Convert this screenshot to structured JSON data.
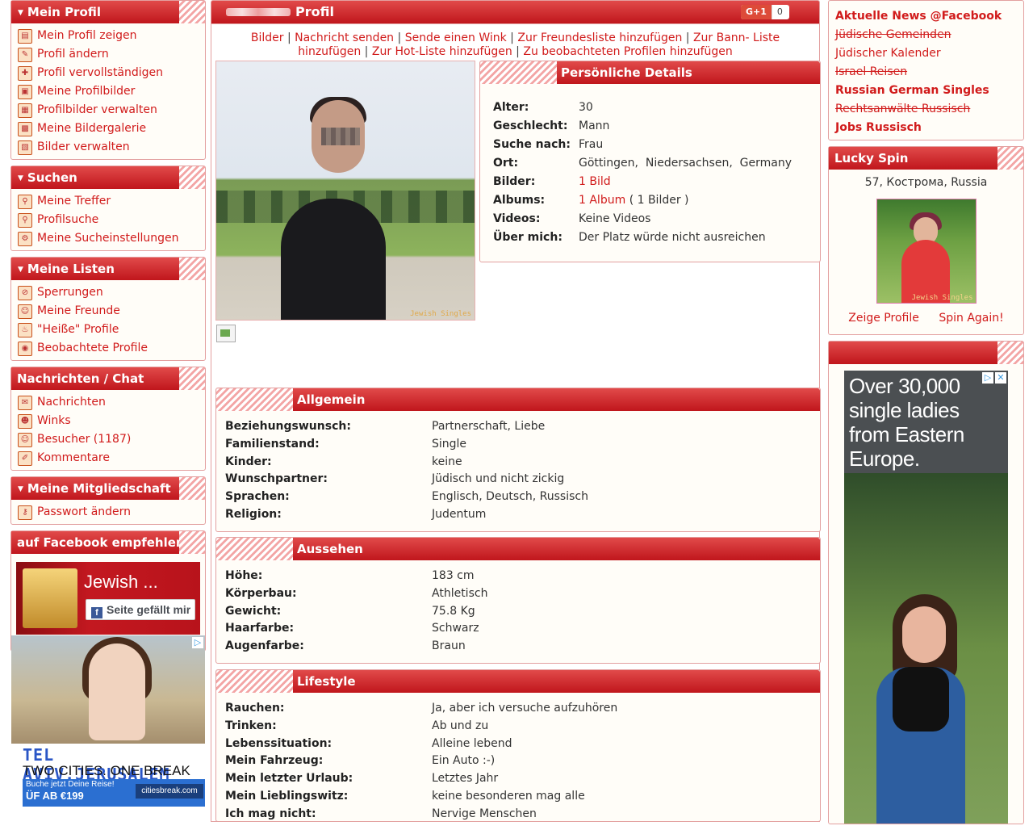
{
  "left": {
    "profil": {
      "title": "Mein Profil",
      "items": [
        "Mein Profil zeigen",
        "Profil ändern",
        "Profil vervollständigen",
        "Meine Profilbilder",
        "Profilbilder verwalten",
        "Meine Bildergalerie",
        "Bilder verwalten"
      ]
    },
    "suchen": {
      "title": "Suchen",
      "items": [
        "Meine Treffer",
        "Profilsuche",
        "Meine Sucheinstellungen"
      ]
    },
    "listen": {
      "title": "Meine Listen",
      "items": [
        "Sperrungen",
        "Meine Freunde",
        "\"Heiße\" Profile",
        "Beobachtete Profile"
      ]
    },
    "nachrichten": {
      "title": "Nachrichten / Chat",
      "items": [
        "Nachrichten",
        "Winks",
        "Besucher (1187)",
        "Kommentare"
      ]
    },
    "mitglied": {
      "title": "Meine Mitgliedschaft",
      "items": [
        "Passwort ändern"
      ]
    },
    "facebook": {
      "title": "auf Facebook empfehlen",
      "page_name": "Jewish ...",
      "like_label": "Seite gefällt mir"
    },
    "ad": {
      "line1": "TEL AVIV.JERUSALEM",
      "line2": "TWO CITIES. ONE BREAK",
      "cta": "Buche jetzt Deine Reise!",
      "price": "ÜF AB €199",
      "brand": "citiesbreak.com"
    }
  },
  "main": {
    "title": "Profil",
    "gplus_label": "G+1",
    "gplus_count": "0",
    "actions": {
      "bilder": "Bilder",
      "nachricht": "Nachricht senden",
      "wink": "Sende einen Wink",
      "freund": "Zur Freundesliste hinzufügen",
      "bann": "Zur Bann- Liste hinzufügen",
      "hot": "Zur Hot-Liste hinzufügen",
      "beobachtet": "Zu beobachteten Profilen hinzufügen"
    },
    "photo_watermark": "Jewish Singles",
    "details": {
      "title": "Persönliche Details",
      "rows": [
        {
          "k": "Alter:",
          "v": "30"
        },
        {
          "k": "Geschlecht:",
          "v": "Mann"
        },
        {
          "k": "Suche nach:",
          "v": "Frau"
        },
        {
          "k": "Ort:",
          "v": "Göttingen,  Niedersachsen,  Germany"
        },
        {
          "k": "Bilder:",
          "v": "1 Bild"
        },
        {
          "k": "Albums:",
          "v": "1 Album"
        },
        {
          "k": "Videos:",
          "v": "Keine Videos"
        },
        {
          "k": "Über mich:",
          "v": "Der Platz würde nicht ausreichen"
        }
      ],
      "album_suffix": "( 1 Bilder )"
    },
    "allgemein": {
      "title": "Allgemein",
      "rows": [
        {
          "k": "Beziehungswunsch:",
          "v": "Partnerschaft, Liebe"
        },
        {
          "k": "Familienstand:",
          "v": "Single"
        },
        {
          "k": "Kinder:",
          "v": "keine"
        },
        {
          "k": "Wunschpartner:",
          "v": "Jüdisch und nicht zickig"
        },
        {
          "k": "Sprachen:",
          "v": "Englisch, Deutsch, Russisch"
        },
        {
          "k": "Religion:",
          "v": "Judentum"
        }
      ]
    },
    "aussehen": {
      "title": "Aussehen",
      "rows": [
        {
          "k": "Höhe:",
          "v": "183 cm"
        },
        {
          "k": "Körperbau:",
          "v": "Athletisch"
        },
        {
          "k": "Gewicht:",
          "v": "75.8 Kg"
        },
        {
          "k": "Haarfarbe:",
          "v": "Schwarz"
        },
        {
          "k": "Augenfarbe:",
          "v": "Braun"
        }
      ]
    },
    "lifestyle": {
      "title": "Lifestyle",
      "rows": [
        {
          "k": "Rauchen:",
          "v": "Ja, aber ich versuche aufzuhören"
        },
        {
          "k": "Trinken:",
          "v": "Ab und zu"
        },
        {
          "k": "Lebenssituation:",
          "v": "Alleine lebend"
        },
        {
          "k": "Mein Fahrzeug:",
          "v": "Ein Auto :-)"
        },
        {
          "k": "Mein letzter Urlaub:",
          "v": "Letztes Jahr"
        },
        {
          "k": "Mein Lieblingswitz:",
          "v": "keine besonderen mag alle"
        },
        {
          "k": "Ich mag nicht:",
          "v": "Nervige Menschen"
        }
      ]
    }
  },
  "right": {
    "news": [
      {
        "label": "Aktuelle News @Facebook",
        "bold": true,
        "strike": false
      },
      {
        "label": "Jüdische Gemeinden",
        "bold": false,
        "strike": true
      },
      {
        "label": "Jüdischer Kalender",
        "bold": false,
        "strike": false
      },
      {
        "label": "Israel Reisen",
        "bold": false,
        "strike": true
      },
      {
        "label": "Russian German Singles",
        "bold": true,
        "strike": false
      },
      {
        "label": "Rechtsanwälte Russisch",
        "bold": false,
        "strike": true
      },
      {
        "label": "Jobs Russisch",
        "bold": true,
        "strike": false
      }
    ],
    "spin": {
      "title": "Lucky Spin",
      "location": "57, Кострома, Russia",
      "watermark": "Jewish Singles",
      "show": "Zeige Profile",
      "again": "Spin Again!"
    },
    "ad": {
      "headline": "Over 30,000 single ladies from Eastern Europe."
    }
  },
  "colors": {
    "accent": "#d11b1b",
    "header_red": "#c0161c",
    "border": "#e3a0a0"
  }
}
